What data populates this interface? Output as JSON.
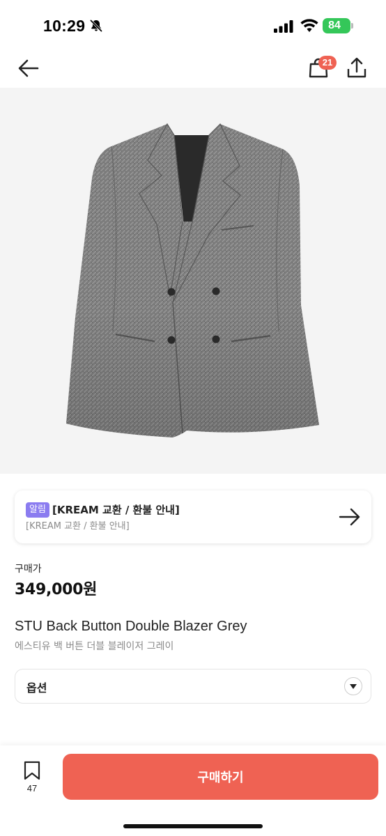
{
  "status_bar": {
    "time": "10:29",
    "battery": "84",
    "icons": [
      "bell-slash-icon",
      "cellular-signal-icon",
      "wifi-icon",
      "battery-charging-icon"
    ]
  },
  "nav": {
    "cart_badge": "21",
    "icons": [
      "arrow-left-icon",
      "shopping-bag-icon",
      "share-icon"
    ]
  },
  "notice": {
    "tag": "알림",
    "title": "[KREAM 교환 / 환불 안내]",
    "subtitle": "[KREAM 교환 / 환불 안내]"
  },
  "price": {
    "label": "구매가",
    "value": "349,000원"
  },
  "product": {
    "name_en": "STU Back Button Double Blazer Grey",
    "name_kr": "에스티유 백 버튼 더블 블레이저 그레이"
  },
  "option": {
    "label": "옵션"
  },
  "bottom_bar": {
    "save_count": "47",
    "buy_label": "구매하기"
  },
  "colors": {
    "accent": "#ef6253",
    "notice_tag": "#8b7cf0",
    "battery": "#34c759"
  }
}
